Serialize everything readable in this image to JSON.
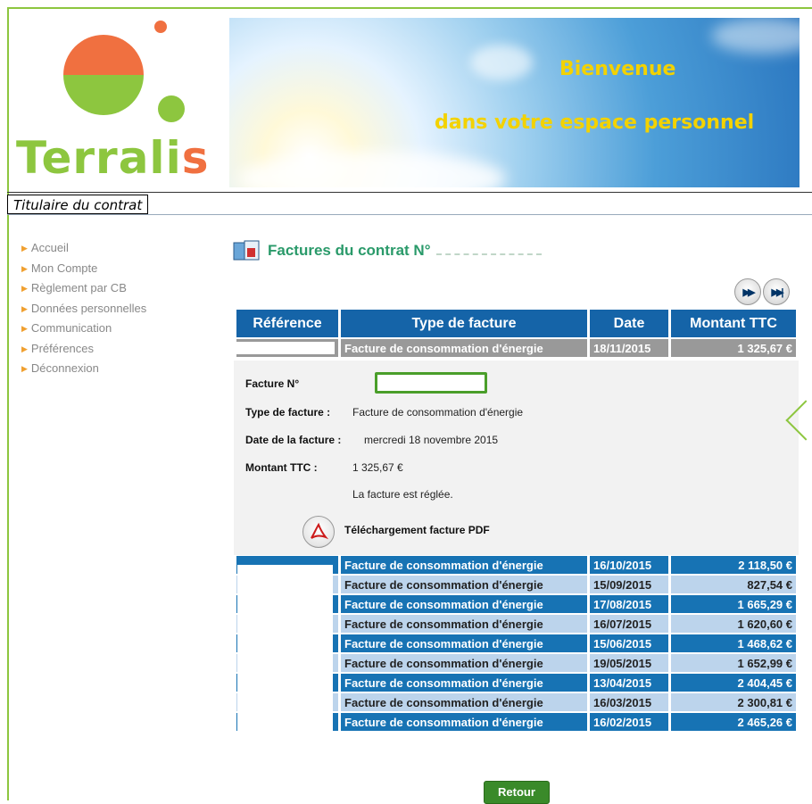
{
  "branding": {
    "logo_text_main": "Terrali",
    "logo_text_last": "s",
    "banner_line1": "Bienvenue",
    "banner_line2": "dans votre espace personnel"
  },
  "header": {
    "titulaire_label": "Titulaire du contrat"
  },
  "sidebar": {
    "items": [
      {
        "label": "Accueil"
      },
      {
        "label": "Mon Compte"
      },
      {
        "label": "Règlement par CB"
      },
      {
        "label": "Données personnelles"
      },
      {
        "label": "Communication"
      },
      {
        "label": "Préférences"
      },
      {
        "label": "Déconnexion"
      }
    ]
  },
  "page": {
    "title": "Factures du contrat N°"
  },
  "table": {
    "headers": [
      "Référence",
      "Type de facture",
      "Date",
      "Montant TTC"
    ],
    "selected": {
      "type": "Facture de consommation d'énergie",
      "date": "18/11/2015",
      "amount": "1 325,67 €"
    },
    "rows": [
      {
        "type": "Facture de consommation d'énergie",
        "date": "16/10/2015",
        "amount": "2 118,50 €"
      },
      {
        "type": "Facture de consommation d'énergie",
        "date": "15/09/2015",
        "amount": "827,54 €"
      },
      {
        "type": "Facture de consommation d'énergie",
        "date": "17/08/2015",
        "amount": "1 665,29 €"
      },
      {
        "type": "Facture de consommation d'énergie",
        "date": "16/07/2015",
        "amount": "1 620,60 €"
      },
      {
        "type": "Facture de consommation d'énergie",
        "date": "15/06/2015",
        "amount": "1 468,62 €"
      },
      {
        "type": "Facture de consommation d'énergie",
        "date": "19/05/2015",
        "amount": "1 652,99 €"
      },
      {
        "type": "Facture de consommation d'énergie",
        "date": "13/04/2015",
        "amount": "2 404,45 €"
      },
      {
        "type": "Facture de consommation d'énergie",
        "date": "16/03/2015",
        "amount": "2 300,81 €"
      },
      {
        "type": "Facture de consommation d'énergie",
        "date": "16/02/2015",
        "amount": "2 465,26 €"
      }
    ]
  },
  "detail": {
    "facture_label": "Facture N°",
    "type_label": "Type de facture :",
    "type_value": "Facture de consommation d'énergie",
    "date_label": "Date de la facture :",
    "date_value": "mercredi 18 novembre 2015",
    "amount_label": "Montant TTC :",
    "amount_value": "1 325,67 €",
    "status": "La facture est réglée.",
    "download_label": "Téléchargement facture PDF"
  },
  "buttons": {
    "retour": "Retour",
    "next_icon": "fast-forward-icon",
    "last_icon": "skip-to-end-icon"
  },
  "colors": {
    "brand_green": "#8dc63f",
    "brand_orange": "#f07040",
    "header_blue": "#1564a8",
    "row_dark": "#1773b4",
    "row_light": "#bcd4ec",
    "title_green": "#2a9a6a"
  }
}
